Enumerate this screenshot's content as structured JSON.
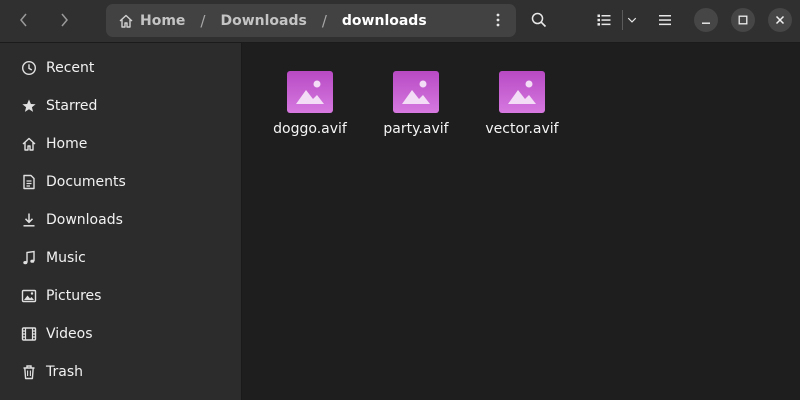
{
  "path": {
    "crumbs": [
      "Home",
      "Downloads",
      "downloads"
    ],
    "separator": "/"
  },
  "headerbar": {
    "icons": {
      "back": "chevron-left-icon",
      "forward": "chevron-right-icon",
      "path_menu": "vertical-dots-icon",
      "search": "search-icon",
      "view_list": "list-view-icon",
      "view_options": "chevron-down-icon",
      "main_menu": "hamburger-menu-icon",
      "minimize": "minimize-icon",
      "maximize": "maximize-icon",
      "close": "close-icon"
    }
  },
  "sidebar": {
    "items": [
      {
        "label": "Recent",
        "icon": "clock-icon"
      },
      {
        "label": "Starred",
        "icon": "star-icon"
      },
      {
        "label": "Home",
        "icon": "home-icon"
      },
      {
        "label": "Documents",
        "icon": "document-icon"
      },
      {
        "label": "Downloads",
        "icon": "download-icon"
      },
      {
        "label": "Music",
        "icon": "music-note-icon"
      },
      {
        "label": "Pictures",
        "icon": "picture-icon"
      },
      {
        "label": "Videos",
        "icon": "film-icon"
      },
      {
        "label": "Trash",
        "icon": "trash-icon"
      }
    ]
  },
  "files": [
    {
      "name": "doggo.avif",
      "icon": "image-file-icon"
    },
    {
      "name": "party.avif",
      "icon": "image-file-icon"
    },
    {
      "name": "vector.avif",
      "icon": "image-file-icon"
    }
  ],
  "colors": {
    "file_icon_top": "#b84ac4",
    "file_icon_bottom": "#d679e0",
    "headerbar": "#303030",
    "sidebar": "#2c2c2c",
    "content": "#1e1e1e"
  }
}
